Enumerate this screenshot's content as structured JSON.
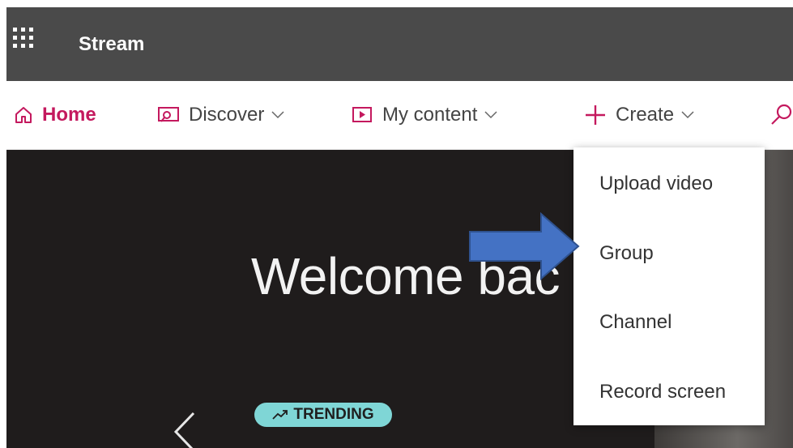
{
  "app": {
    "title": "Stream"
  },
  "nav": {
    "items": [
      {
        "label": "Home",
        "icon": "home-icon",
        "active": true
      },
      {
        "label": "Discover",
        "icon": "discover-icon",
        "chevron": true
      },
      {
        "label": "My content",
        "icon": "my-content-icon",
        "chevron": true
      },
      {
        "label": "Create",
        "icon": "plus-icon",
        "chevron": true
      },
      {
        "label": "",
        "icon": "search-icon"
      }
    ]
  },
  "hero": {
    "welcome_text": "Welcome bac",
    "trending_label": "TRENDING"
  },
  "create_menu": {
    "items": [
      {
        "label": "Upload video"
      },
      {
        "label": "Group"
      },
      {
        "label": "Channel"
      },
      {
        "label": "Record screen"
      }
    ]
  },
  "colors": {
    "accent": "#c4195e",
    "appbar": "#4a4a4a",
    "hero_bg": "#1f1c1c",
    "trending_badge": "#7fd6d6",
    "callout_arrow": "#4472c4"
  }
}
